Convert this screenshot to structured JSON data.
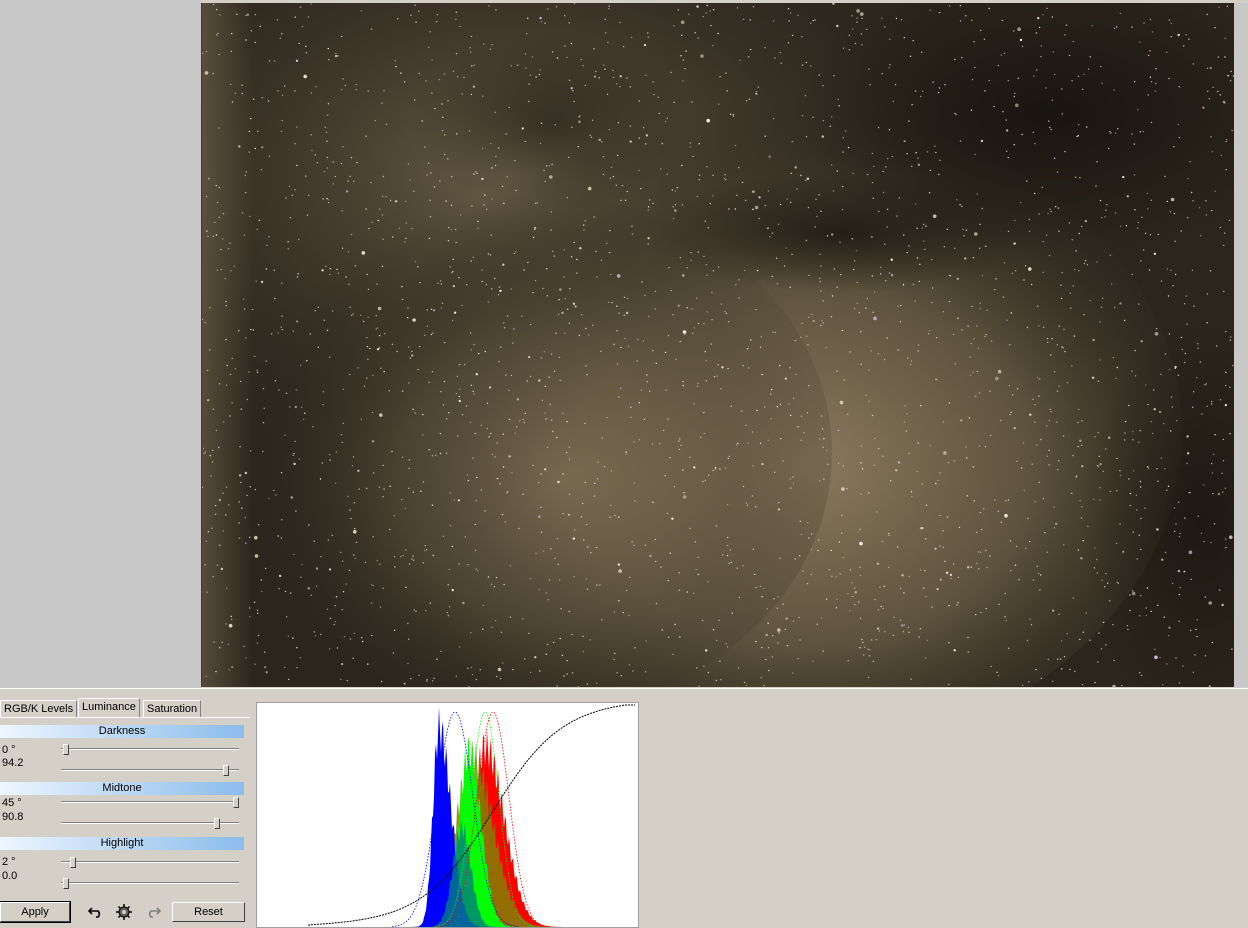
{
  "tabs": [
    {
      "label": "RGB/K Levels",
      "active": false
    },
    {
      "label": "Luminance",
      "active": true
    },
    {
      "label": "Saturation",
      "active": false
    }
  ],
  "sections": {
    "darkness": {
      "title": "Darkness",
      "angle": "0 °",
      "value": "94.2",
      "angle_slider": 0.01,
      "value_slider": 0.94
    },
    "midtone": {
      "title": "Midtone",
      "angle": "45 °",
      "value": "90.8",
      "angle_slider": 1.0,
      "value_slider": 0.89
    },
    "highlight": {
      "title": "Highlight",
      "angle": "2 °",
      "value": "0.0",
      "angle_slider": 0.05,
      "value_slider": 0.01
    }
  },
  "buttons": {
    "apply": "Apply",
    "reset": "Reset"
  },
  "icons": [
    "undo-icon",
    "settings-icon",
    "redo-icon"
  ],
  "colors": {
    "blue": "#0000ff",
    "green": "#00ff00",
    "red": "#ff0000",
    "curve": "#000000",
    "header_start": "#eef6ff",
    "header_end": "#8cbcec"
  }
}
